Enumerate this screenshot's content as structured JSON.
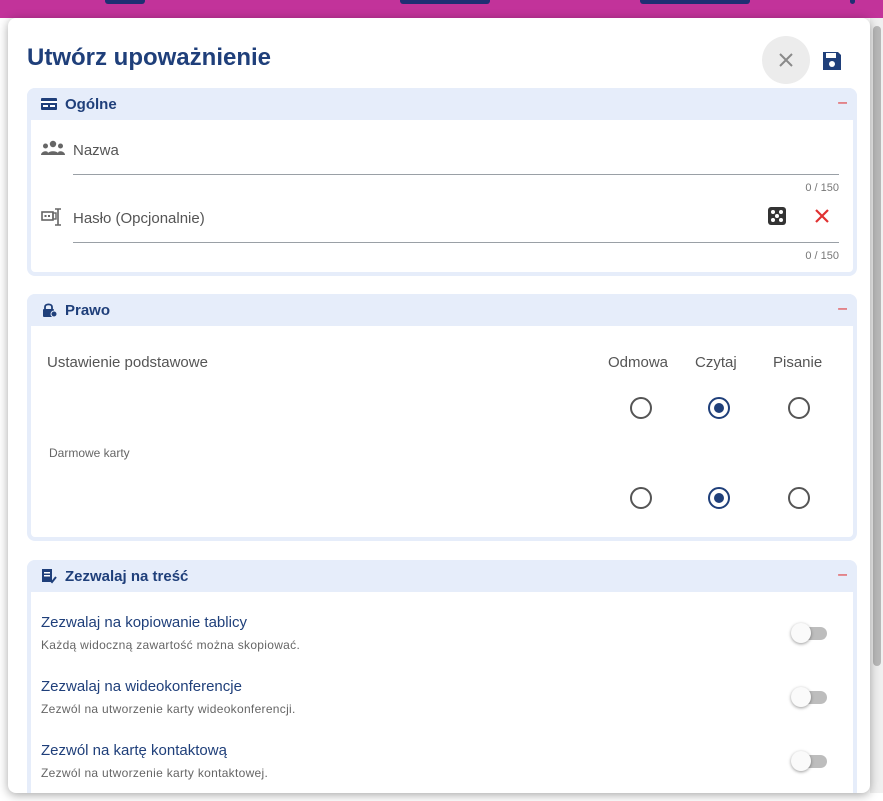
{
  "dialog": {
    "title": "Utwórz upoważnienie",
    "close_icon": "close-icon",
    "save_icon": "save-icon"
  },
  "general": {
    "title": "Ogólne",
    "collapse": "–",
    "name": {
      "label": "Nazwa",
      "counter": "0 / 150"
    },
    "password": {
      "label": "Hasło (Opcjonalnie)",
      "counter": "0 / 150"
    }
  },
  "rights": {
    "title": "Prawo",
    "collapse": "–",
    "columns": [
      "Odmowa",
      "Czytaj",
      "Pisanie"
    ],
    "rows": [
      {
        "label": "Ustawienie podstawowe",
        "selected": "Czytaj"
      },
      {
        "label": "Darmowe karty",
        "selected": "Czytaj"
      }
    ]
  },
  "content": {
    "title": "Zezwalaj na treść",
    "collapse": "–",
    "options": [
      {
        "title": "Zezwalaj na kopiowanie tablicy",
        "desc": "Każdą widoczną zawartość można skopiować.",
        "enabled": false
      },
      {
        "title": "Zezwalaj na wideokonferencje",
        "desc": "Zezwól na utworzenie karty wideokonferencji.",
        "enabled": false
      },
      {
        "title": "Zezwól na kartę kontaktową",
        "desc": "Zezwól na utworzenie karty kontaktowej.",
        "enabled": false
      }
    ]
  },
  "colors": {
    "accent": "#1f3f7a",
    "header_bg": "#e6edfa",
    "danger": "#e03131",
    "topbar": "#c2339a"
  }
}
